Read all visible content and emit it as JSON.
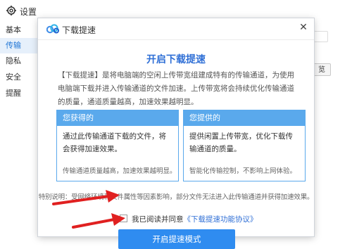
{
  "background_window": {
    "title": "设置",
    "sidebar": [
      {
        "label": "基本"
      },
      {
        "label": "传输"
      },
      {
        "label": "隐私"
      },
      {
        "label": "安全"
      },
      {
        "label": "提醒"
      }
    ],
    "right_button_label": "览"
  },
  "dialog": {
    "title": "下载提速",
    "heading": "开启下载提速",
    "intro": "【下载提速】是将电脑端的空闲上传带宽组建成特有的传输通道，为使用电脑端下载并进入传输通道的文件加速。上传带宽将会持续优化传输通道的质量，通道质量越高，加速效果越明显。",
    "cards": [
      {
        "title": "您获得的",
        "body": "通过此传输通道下载的文件，将会获得加速效果。",
        "note": "传输通道质量越高，加速效果越明显。"
      },
      {
        "title": "您提供的",
        "body": "提供闲置上传带宽，优化下载传输通道的质量。",
        "note": "智能化传输控制，不影响上网体验。"
      }
    ],
    "special_note": "特别说明：受网络环境和文件属性等因素影响，部分文件无法进入此传输通道并获得加速效果。",
    "agree_text": "我已阅读并同意",
    "agree_link": "《下载提速功能协议》",
    "start_button": "开启提速模式"
  },
  "colors": {
    "accent": "#2f8cf0",
    "card_border": "#5aa9ec",
    "heading": "#2f6fd6",
    "arrow": "#e02020"
  }
}
